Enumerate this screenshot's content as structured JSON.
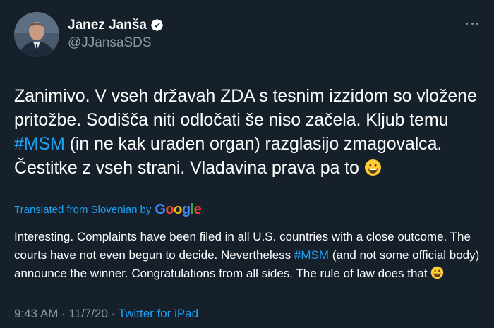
{
  "author": {
    "display_name": "Janez Janša",
    "handle": "@JJansaSDS",
    "verified": true,
    "avatar_icon": "profile-photo"
  },
  "tweet": {
    "text_part1": "Zanimivo. V vseh državah ZDA s tesnim izzidom so vložene pritožbe. Sodišča niti odločati še niso začela. Kljub temu ",
    "hashtag": "#MSM",
    "text_part2": " (in ne kak uraden organ) razglasijo zmagovalca. Čestitke z vseh strani. Vladavina prava pa to ",
    "emoji": "grinning-face-emoji"
  },
  "translation": {
    "label": "Translated from Slovenian",
    "by": "by",
    "provider": "Google",
    "text_part1": "Interesting. Complaints have been filed in all U.S. countries with a close outcome. The courts have not even begun to decide. Nevertheless ",
    "hashtag": "#MSM",
    "text_part2": " (and not some official body) announce the winner. Congratulations from all sides. The rule of law does that ",
    "emoji": "grinning-face-emoji"
  },
  "meta": {
    "time": "9:43 AM",
    "separator1": " · ",
    "date": "11/7/20",
    "separator2": " · ",
    "source": "Twitter for iPad"
  },
  "colors": {
    "background": "#15202b",
    "link": "#1da1f2",
    "secondary_text": "#8899a6"
  }
}
